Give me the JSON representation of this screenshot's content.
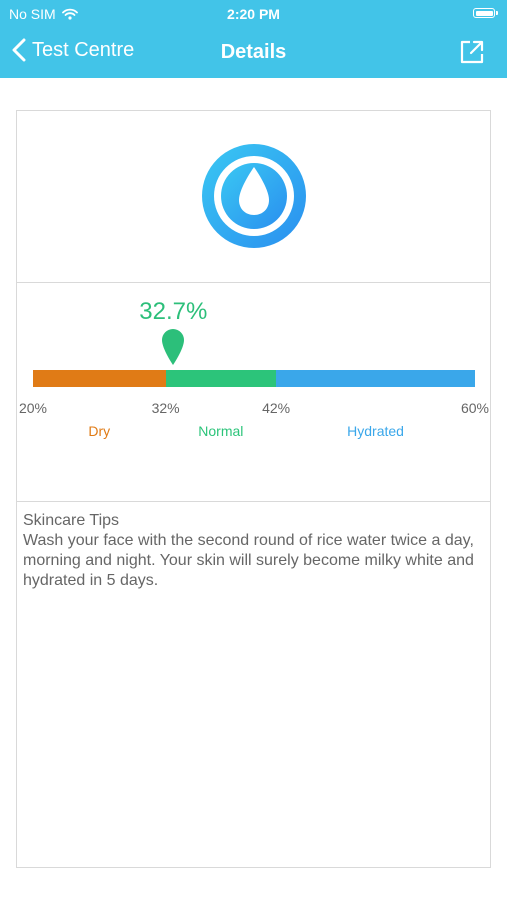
{
  "status_bar": {
    "carrier": "No SIM",
    "time": "2:20 PM"
  },
  "nav": {
    "back_label": "Test Centre",
    "title": "Details"
  },
  "meter": {
    "reading": "32.7%",
    "value": 32.7,
    "min": 20,
    "max": 60,
    "segments": [
      {
        "name": "Dry",
        "from": 20,
        "to": 32,
        "color": "#e07b16"
      },
      {
        "name": "Normal",
        "from": 32,
        "to": 42,
        "color": "#2cc47a"
      },
      {
        "name": "Hydrated",
        "from": 42,
        "to": 60,
        "color": "#3aa7ea"
      }
    ],
    "ticks": [
      "20%",
      "32%",
      "42%",
      "60%"
    ],
    "marker_color": "#2cbf7a"
  },
  "tips": {
    "title": "Skincare Tips",
    "body": "Wash your face with the second round of rice water twice a day, morning and night. Your skin will surely become milky white and hydrated in 5 days."
  },
  "colors": {
    "header": "#42c4e8",
    "accent_blue": "#3aa7ea"
  },
  "icons": {
    "status": [
      "wifi-icon",
      "battery-icon"
    ],
    "nav": [
      "back-chevron-icon",
      "share-icon"
    ],
    "badge": "water-drop-icon"
  }
}
